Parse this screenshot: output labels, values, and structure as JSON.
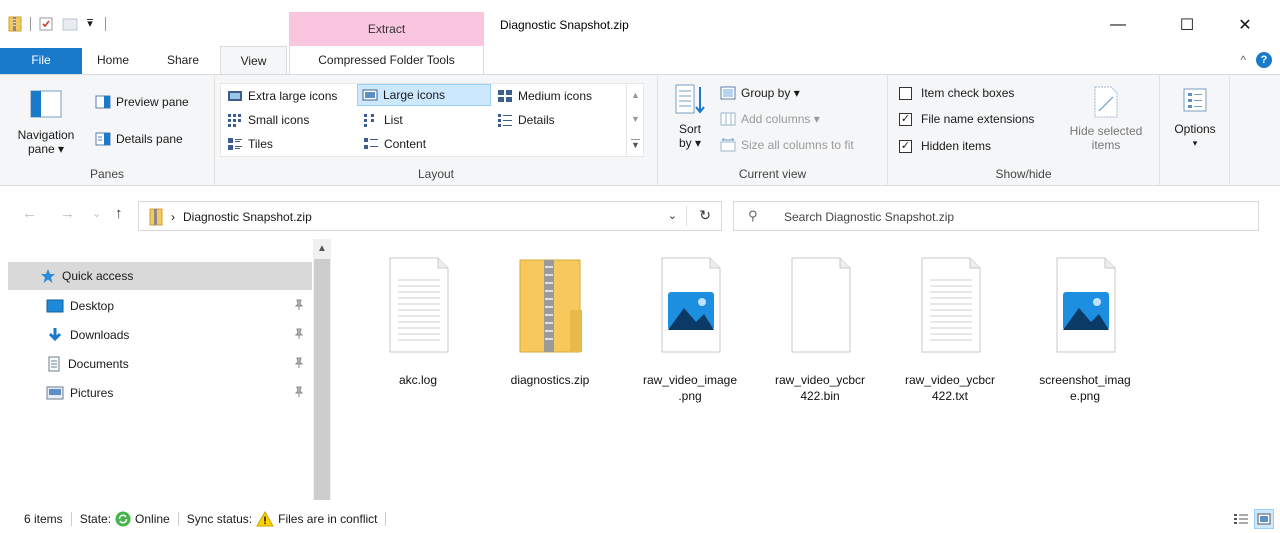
{
  "window": {
    "title": "Diagnostic Snapshot.zip",
    "contextual_tab_group": "Extract",
    "minimize": "—",
    "maximize": "☐",
    "close": "✕"
  },
  "quick_access_toolbar": {
    "icons": [
      "zip-folder-icon",
      "properties-icon",
      "new-folder-icon",
      "customize-icon"
    ],
    "customize_glyph": "▾"
  },
  "tabs": [
    "File",
    "Home",
    "Share",
    "View",
    "Compressed Folder Tools"
  ],
  "active_tab": "View",
  "tabs_right": {
    "collapse_glyph": "^",
    "help_glyph": "?"
  },
  "ribbon": {
    "panes": {
      "label": "Panes",
      "navigation_pane_line1": "Navigation",
      "navigation_pane_line2": "pane ▾",
      "preview_pane": "Preview pane",
      "details_pane": "Details pane"
    },
    "layout": {
      "label": "Layout",
      "items": [
        "Extra large icons",
        "Large icons",
        "Medium icons",
        "Small icons",
        "List",
        "Details",
        "Tiles",
        "Content"
      ],
      "selected": "Large icons",
      "scroll_up": "▲",
      "scroll_down": "▼",
      "scroll_more": "▼"
    },
    "current_view": {
      "label": "Current view",
      "sort_line1": "Sort",
      "sort_line2": "by ▾",
      "group_by": "Group by ▾",
      "add_columns": "Add columns ▾",
      "size_columns": "Size all columns to fit"
    },
    "show_hide": {
      "label": "Show/hide",
      "item_check_boxes": "Item check boxes",
      "item_check_boxes_checked": false,
      "file_name_extensions": "File name extensions",
      "file_name_extensions_checked": true,
      "hidden_items": "Hidden items",
      "hidden_items_checked": true,
      "hide_selected_line1": "Hide selected",
      "hide_selected_line2": "items",
      "check_glyph": "✓"
    },
    "options": {
      "label": "Options",
      "arrow": "▾"
    }
  },
  "address": {
    "back": "←",
    "forward": "→",
    "recent": "⌄",
    "up": "↑",
    "breadcrumb_sep": "›",
    "breadcrumb": "Diagnostic Snapshot.zip",
    "dropdown": "⌄",
    "refresh": "↻"
  },
  "search": {
    "placeholder": "Search Diagnostic Snapshot.zip",
    "icon_glyph": "⚲"
  },
  "nav_pane": {
    "quick_access": "Quick access",
    "items": [
      {
        "label": "Desktop",
        "icon": "desktop-icon"
      },
      {
        "label": "Downloads",
        "icon": "downloads-icon"
      },
      {
        "label": "Documents",
        "icon": "documents-icon"
      },
      {
        "label": "Pictures",
        "icon": "pictures-icon"
      }
    ],
    "pin_glyph": "📌",
    "scroll_up": "▲"
  },
  "files": [
    {
      "name": "akc.log",
      "type": "text"
    },
    {
      "name": "diagnostics.zip",
      "type": "zip"
    },
    {
      "name": "raw_video_image\n.png",
      "type": "image"
    },
    {
      "name": "raw_video_ycbcr\n422.bin",
      "type": "blank"
    },
    {
      "name": "raw_video_ycbcr\n422.txt",
      "type": "text"
    },
    {
      "name": "screenshot_imag\ne.png",
      "type": "image"
    }
  ],
  "status": {
    "items_count": "6 items",
    "state_label": "State:",
    "state_value": "Online",
    "sync_label": "Sync status:",
    "sync_value": "Files are in conflict",
    "warning_glyph": "!"
  },
  "colors": {
    "accent": "#1979ca",
    "extract_tab": "#f9c5df",
    "selection": "#cce8ff",
    "zip_folder": "#f7c95c",
    "online_green": "#45b549",
    "warning": "#ffd300"
  }
}
